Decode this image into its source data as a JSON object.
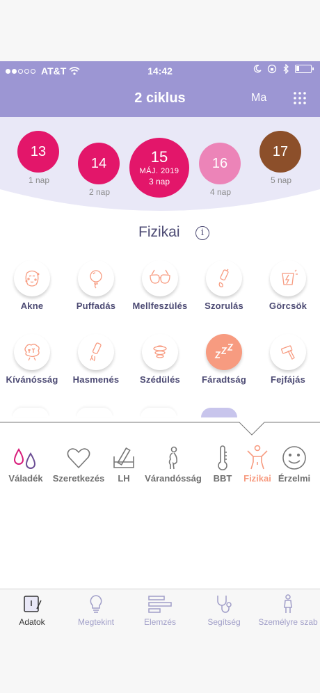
{
  "status": {
    "carrier": "AT&T",
    "time": "14:42"
  },
  "nav": {
    "title": "2 ciklus",
    "today": "Ma"
  },
  "days": [
    {
      "num": "13",
      "label": "1 nap",
      "color": "#e3166a"
    },
    {
      "num": "14",
      "label": "2 nap",
      "color": "#e3166a"
    },
    {
      "num": "15",
      "label": "3 nap",
      "month": "MÁJ. 2019",
      "color": "#e3166a",
      "selected": true
    },
    {
      "num": "16",
      "label": "4 nap",
      "color": "#ec84b8"
    },
    {
      "num": "17",
      "label": "5 nap",
      "color": "#8c4f2a"
    }
  ],
  "section": {
    "title": "Fizikai"
  },
  "symptoms": [
    {
      "label": "Akne",
      "icon": "acne-icon"
    },
    {
      "label": "Puffadás",
      "icon": "bloating-icon"
    },
    {
      "label": "Mellfeszülés",
      "icon": "breast-tenderness-icon"
    },
    {
      "label": "Szorulás",
      "icon": "constipation-icon"
    },
    {
      "label": "Görcsök",
      "icon": "cramps-icon"
    },
    {
      "label": "Kívánósság",
      "icon": "cravings-icon"
    },
    {
      "label": "Hasmenés",
      "icon": "diarrhea-icon"
    },
    {
      "label": "Szédülés",
      "icon": "dizziness-icon"
    },
    {
      "label": "Fáradtság",
      "icon": "fatigue-icon",
      "selected": true
    },
    {
      "label": "Fejfájás",
      "icon": "headache-icon"
    }
  ],
  "categories": [
    {
      "label": "Váladék",
      "icon": "discharge-icon"
    },
    {
      "label": "Szeretkezés",
      "icon": "heart-icon"
    },
    {
      "label": "LH",
      "icon": "lh-test-icon"
    },
    {
      "label": "Várandósság",
      "icon": "pregnancy-icon"
    },
    {
      "label": "BBT",
      "icon": "thermometer-icon"
    },
    {
      "label": "Fizikai",
      "icon": "physical-icon",
      "active": true
    },
    {
      "label": "Érzelmi",
      "icon": "smiley-icon"
    }
  ],
  "tabs": [
    {
      "label": "Adatok",
      "icon": "calendar-edit-icon",
      "active": true
    },
    {
      "label": "Megtekint",
      "icon": "lightbulb-icon"
    },
    {
      "label": "Elemzés",
      "icon": "bars-icon"
    },
    {
      "label": "Segítség",
      "icon": "stethoscope-icon"
    },
    {
      "label": "Személyre szab",
      "icon": "person-icon"
    }
  ],
  "colors": {
    "header": "#9c96d3",
    "primary_text": "#4c4a73",
    "accent": "#f79b80",
    "period": "#e3166a"
  }
}
